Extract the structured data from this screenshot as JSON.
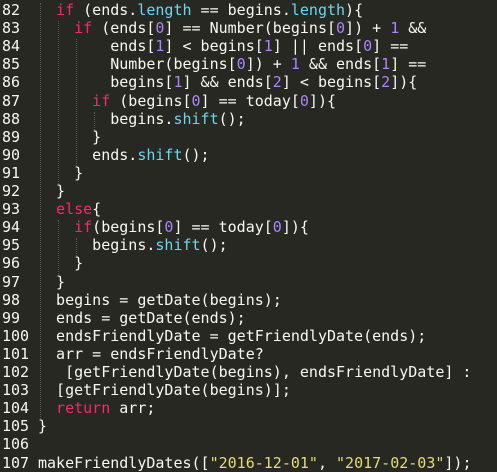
{
  "theme": {
    "background": "#272822",
    "text": "#f8f8f2",
    "keyword": "#f92672",
    "property": "#66d9ef",
    "number": "#ae81ff",
    "string": "#e6db74"
  },
  "lines": [
    {
      "n": "82",
      "indent": 2,
      "tokens": [
        [
          "kw",
          "if"
        ],
        [
          "plain",
          " (ends."
        ],
        [
          "prop",
          "length"
        ],
        [
          "plain",
          " == begins."
        ],
        [
          "prop",
          "length"
        ],
        [
          "plain",
          "){"
        ]
      ]
    },
    {
      "n": "83",
      "indent": 4,
      "tokens": [
        [
          "kw",
          "if"
        ],
        [
          "plain",
          " (ends["
        ],
        [
          "num",
          "0"
        ],
        [
          "plain",
          "] == Number(begins["
        ],
        [
          "num",
          "0"
        ],
        [
          "plain",
          "]) + "
        ],
        [
          "num",
          "1"
        ],
        [
          "plain",
          " &&"
        ]
      ]
    },
    {
      "n": "84",
      "indent": 8,
      "tokens": [
        [
          "plain",
          "ends["
        ],
        [
          "num",
          "1"
        ],
        [
          "plain",
          "] < begins["
        ],
        [
          "num",
          "1"
        ],
        [
          "plain",
          "] || ends["
        ],
        [
          "num",
          "0"
        ],
        [
          "plain",
          "] =="
        ]
      ]
    },
    {
      "n": "85",
      "indent": 8,
      "tokens": [
        [
          "plain",
          "Number(begins["
        ],
        [
          "num",
          "0"
        ],
        [
          "plain",
          "]) + "
        ],
        [
          "num",
          "1"
        ],
        [
          "plain",
          " && ends["
        ],
        [
          "num",
          "1"
        ],
        [
          "plain",
          "] =="
        ]
      ]
    },
    {
      "n": "86",
      "indent": 8,
      "tokens": [
        [
          "plain",
          "begins["
        ],
        [
          "num",
          "1"
        ],
        [
          "plain",
          "] && ends["
        ],
        [
          "num",
          "2"
        ],
        [
          "plain",
          "] < begins["
        ],
        [
          "num",
          "2"
        ],
        [
          "plain",
          "]){"
        ]
      ]
    },
    {
      "n": "87",
      "indent": 6,
      "tokens": [
        [
          "kw",
          "if"
        ],
        [
          "plain",
          " (begins["
        ],
        [
          "num",
          "0"
        ],
        [
          "plain",
          "] == today["
        ],
        [
          "num",
          "0"
        ],
        [
          "plain",
          "]){"
        ]
      ]
    },
    {
      "n": "88",
      "indent": 8,
      "tokens": [
        [
          "plain",
          "begins."
        ],
        [
          "prop",
          "shift"
        ],
        [
          "plain",
          "();"
        ]
      ]
    },
    {
      "n": "89",
      "indent": 6,
      "tokens": [
        [
          "plain",
          "}"
        ]
      ]
    },
    {
      "n": "90",
      "indent": 6,
      "tokens": [
        [
          "plain",
          "ends."
        ],
        [
          "prop",
          "shift"
        ],
        [
          "plain",
          "();"
        ]
      ]
    },
    {
      "n": "91",
      "indent": 4,
      "tokens": [
        [
          "plain",
          "}"
        ]
      ]
    },
    {
      "n": "92",
      "indent": 2,
      "tokens": [
        [
          "plain",
          "}"
        ]
      ]
    },
    {
      "n": "93",
      "indent": 2,
      "tokens": [
        [
          "kw",
          "else"
        ],
        [
          "plain",
          "{"
        ]
      ]
    },
    {
      "n": "94",
      "indent": 4,
      "tokens": [
        [
          "kw",
          "if"
        ],
        [
          "plain",
          "(begins["
        ],
        [
          "num",
          "0"
        ],
        [
          "plain",
          "] == today["
        ],
        [
          "num",
          "0"
        ],
        [
          "plain",
          "]){"
        ]
      ]
    },
    {
      "n": "95",
      "indent": 6,
      "tokens": [
        [
          "plain",
          "begins."
        ],
        [
          "prop",
          "shift"
        ],
        [
          "plain",
          "();"
        ]
      ]
    },
    {
      "n": "96",
      "indent": 4,
      "tokens": [
        [
          "plain",
          "}"
        ]
      ]
    },
    {
      "n": "97",
      "indent": 2,
      "tokens": [
        [
          "plain",
          "}"
        ]
      ]
    },
    {
      "n": "98",
      "indent": 2,
      "tokens": [
        [
          "plain",
          "begins = getDate(begins);"
        ]
      ]
    },
    {
      "n": "99",
      "indent": 2,
      "tokens": [
        [
          "plain",
          "ends = getDate(ends);"
        ]
      ]
    },
    {
      "n": "100",
      "indent": 2,
      "tokens": [
        [
          "plain",
          "endsFriendlyDate = getFriendlyDate(ends);"
        ]
      ]
    },
    {
      "n": "101",
      "indent": 2,
      "tokens": [
        [
          "plain",
          "arr = endsFriendlyDate?"
        ]
      ]
    },
    {
      "n": "102",
      "indent": 3,
      "tokens": [
        [
          "plain",
          "[getFriendlyDate(begins), endsFriendlyDate] :"
        ]
      ]
    },
    {
      "n": "103",
      "indent": 2,
      "tokens": [
        [
          "plain",
          "[getFriendlyDate(begins)];"
        ]
      ]
    },
    {
      "n": "104",
      "indent": 2,
      "tokens": [
        [
          "kw",
          "return"
        ],
        [
          "plain",
          " arr;"
        ]
      ]
    },
    {
      "n": "105",
      "indent": 0,
      "tokens": [
        [
          "plain",
          "}"
        ]
      ]
    },
    {
      "n": "106",
      "indent": 0,
      "tokens": []
    },
    {
      "n": "107",
      "indent": 0,
      "tokens": [
        [
          "plain",
          "makeFriendlyDates(["
        ],
        [
          "str",
          "\"2016-12-01\""
        ],
        [
          "plain",
          ", "
        ],
        [
          "str",
          "\"2017-02-03\""
        ],
        [
          "plain",
          "]);"
        ]
      ]
    }
  ]
}
